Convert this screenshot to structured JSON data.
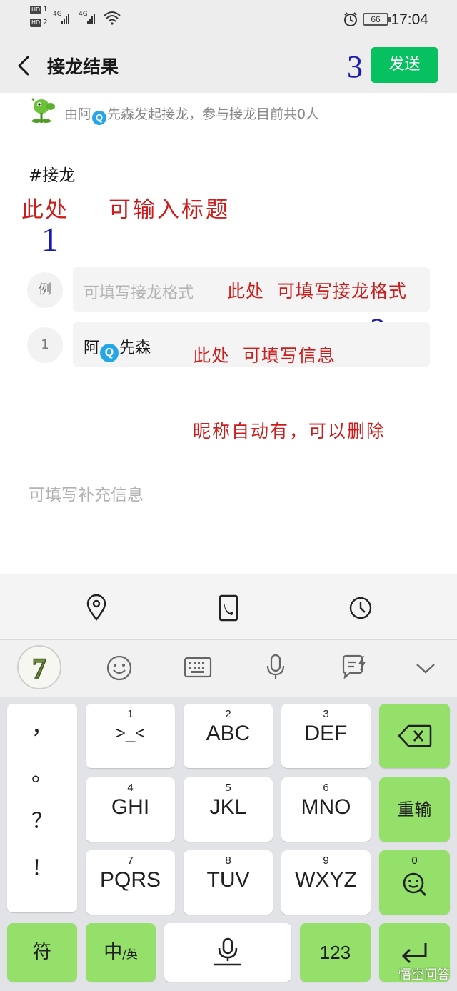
{
  "status_bar": {
    "hd1": "HD",
    "hd2": "HD",
    "sim1": "1",
    "sim2": "2",
    "net1": "4G",
    "net2": "4G",
    "battery": "66",
    "time": "17:04"
  },
  "header": {
    "title": "接龙结果",
    "send_label": "发送",
    "annotation_number": "3"
  },
  "initiator": {
    "prefix": "由阿",
    "q": "Q",
    "suffix": "先森发起接龙，参与接龙目前共0人"
  },
  "content": {
    "tag": "#接龙",
    "annotation1_a": "此处",
    "annotation1_b": "可输入标题",
    "annotation_number1": "1",
    "example_badge": "例",
    "example_placeholder": "可填写接龙格式",
    "annotation2_a": "此处  可填写接龙格式",
    "annotation_number2": "2",
    "entry_badge": "1",
    "entry_prefix": "阿",
    "entry_q": "Q",
    "entry_suffix": "先森",
    "annotation2_b": "此处  可填写信息",
    "annotation3": "昵称自动有，可以删除",
    "extra_placeholder": "可填写补充信息"
  },
  "toolbar": {
    "icons": [
      "location-pin-icon",
      "phone-icon",
      "clock-icon"
    ]
  },
  "keyboard": {
    "skin": "7",
    "punctuation": [
      "，",
      "。",
      "？",
      "！"
    ],
    "rows": [
      [
        {
          "num": "1",
          "label": ">_<"
        },
        {
          "num": "2",
          "label": "ABC"
        },
        {
          "num": "3",
          "label": "DEF"
        }
      ],
      [
        {
          "num": "4",
          "label": "GHI"
        },
        {
          "num": "5",
          "label": "JKL"
        },
        {
          "num": "6",
          "label": "MNO"
        }
      ],
      [
        {
          "num": "7",
          "label": "PQRS"
        },
        {
          "num": "8",
          "label": "TUV"
        },
        {
          "num": "9",
          "label": "WXYZ"
        }
      ]
    ],
    "reinput": "重输",
    "zero": "0",
    "symbol": "符",
    "lang_zh": "中",
    "lang_en": "/英",
    "numbers": "123"
  },
  "watermark": "悟空问答",
  "colors": {
    "accent_green": "#07c160",
    "key_green": "#95e06a",
    "annotation_red": "#cc1d1d",
    "annotation_blue": "#1b1bb0"
  }
}
